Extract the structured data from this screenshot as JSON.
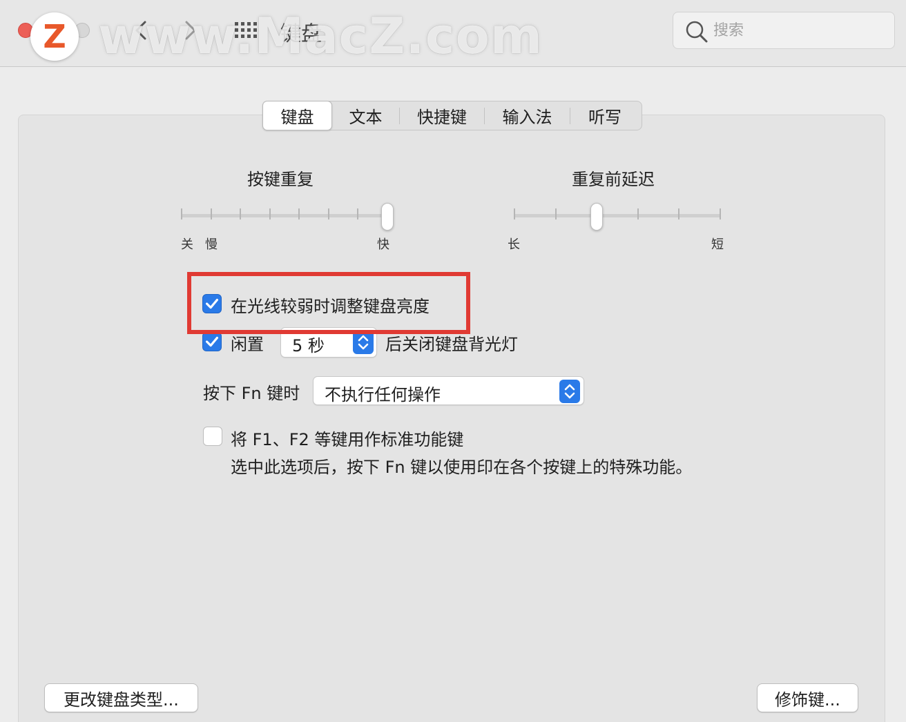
{
  "window": {
    "title": "键盘",
    "watermark": "www.MacZ.com",
    "logo_letter": "Z"
  },
  "search": {
    "placeholder": "搜索"
  },
  "tabs": [
    {
      "label": "键盘",
      "active": true
    },
    {
      "label": "文本",
      "active": false
    },
    {
      "label": "快捷键",
      "active": false
    },
    {
      "label": "输入法",
      "active": false
    },
    {
      "label": "听写",
      "active": false
    }
  ],
  "key_repeat": {
    "title": "按键重复",
    "labels": {
      "off": "关",
      "slow": "慢",
      "fast": "快"
    },
    "ticks": 8,
    "value_index": 7
  },
  "repeat_delay": {
    "title": "重复前延迟",
    "labels": {
      "long": "长",
      "short": "短"
    },
    "ticks": 6,
    "value_index": 2
  },
  "options": {
    "adjust_brightness": {
      "label": "在光线较弱时调整键盘亮度",
      "checked": true
    },
    "backlight_off": {
      "prefix": "闲置",
      "value": "5 秒",
      "suffix": "后关闭键盘背光灯",
      "checked": true
    },
    "fn_key": {
      "label": "按下 Fn 键时",
      "value": "不执行任何操作"
    },
    "standard_function_keys": {
      "label": "将 F1、F2 等键用作标准功能键",
      "description": "选中此选项后，按下 Fn 键以使用印在各个按键上的特殊功能。",
      "checked": false
    }
  },
  "buttons": {
    "change_keyboard_type": "更改键盘类型...",
    "modifier_keys": "修饰键..."
  },
  "colors": {
    "accent": "#2a7ae8",
    "highlight": "#e03a33",
    "close": "#ec5f57"
  }
}
